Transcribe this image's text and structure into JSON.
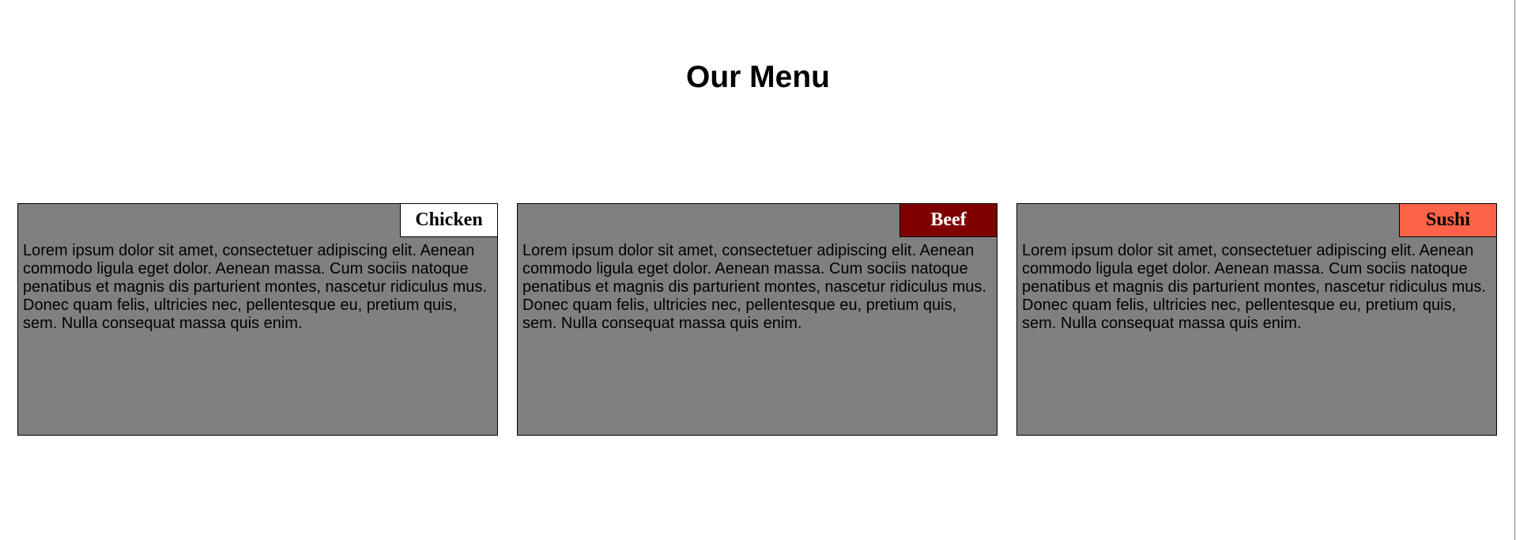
{
  "page": {
    "title": "Our Menu"
  },
  "menu": {
    "items": [
      {
        "name": "Chicken",
        "tag_bg": "#ffffff",
        "tag_fg": "#000000",
        "description": "Lorem ipsum dolor sit amet, consectetuer adipiscing elit. Aenean commodo ligula eget dolor. Aenean massa. Cum sociis natoque penatibus et magnis dis parturient montes, nascetur ridiculus mus. Donec quam felis, ultricies nec, pellentesque eu, pretium quis, sem. Nulla consequat massa quis enim."
      },
      {
        "name": "Beef",
        "tag_bg": "#800000",
        "tag_fg": "#ffffff",
        "description": "Lorem ipsum dolor sit amet, consectetuer adipiscing elit. Aenean commodo ligula eget dolor. Aenean massa. Cum sociis natoque penatibus et magnis dis parturient montes, nascetur ridiculus mus. Donec quam felis, ultricies nec, pellentesque eu, pretium quis, sem. Nulla consequat massa quis enim."
      },
      {
        "name": "Sushi",
        "tag_bg": "#ff6347",
        "tag_fg": "#000000",
        "description": "Lorem ipsum dolor sit amet, consectetuer adipiscing elit. Aenean commodo ligula eget dolor. Aenean massa. Cum sociis natoque penatibus et magnis dis parturient montes, nascetur ridiculus mus. Donec quam felis, ultricies nec, pellentesque eu, pretium quis, sem. Nulla consequat massa quis enim."
      }
    ]
  }
}
